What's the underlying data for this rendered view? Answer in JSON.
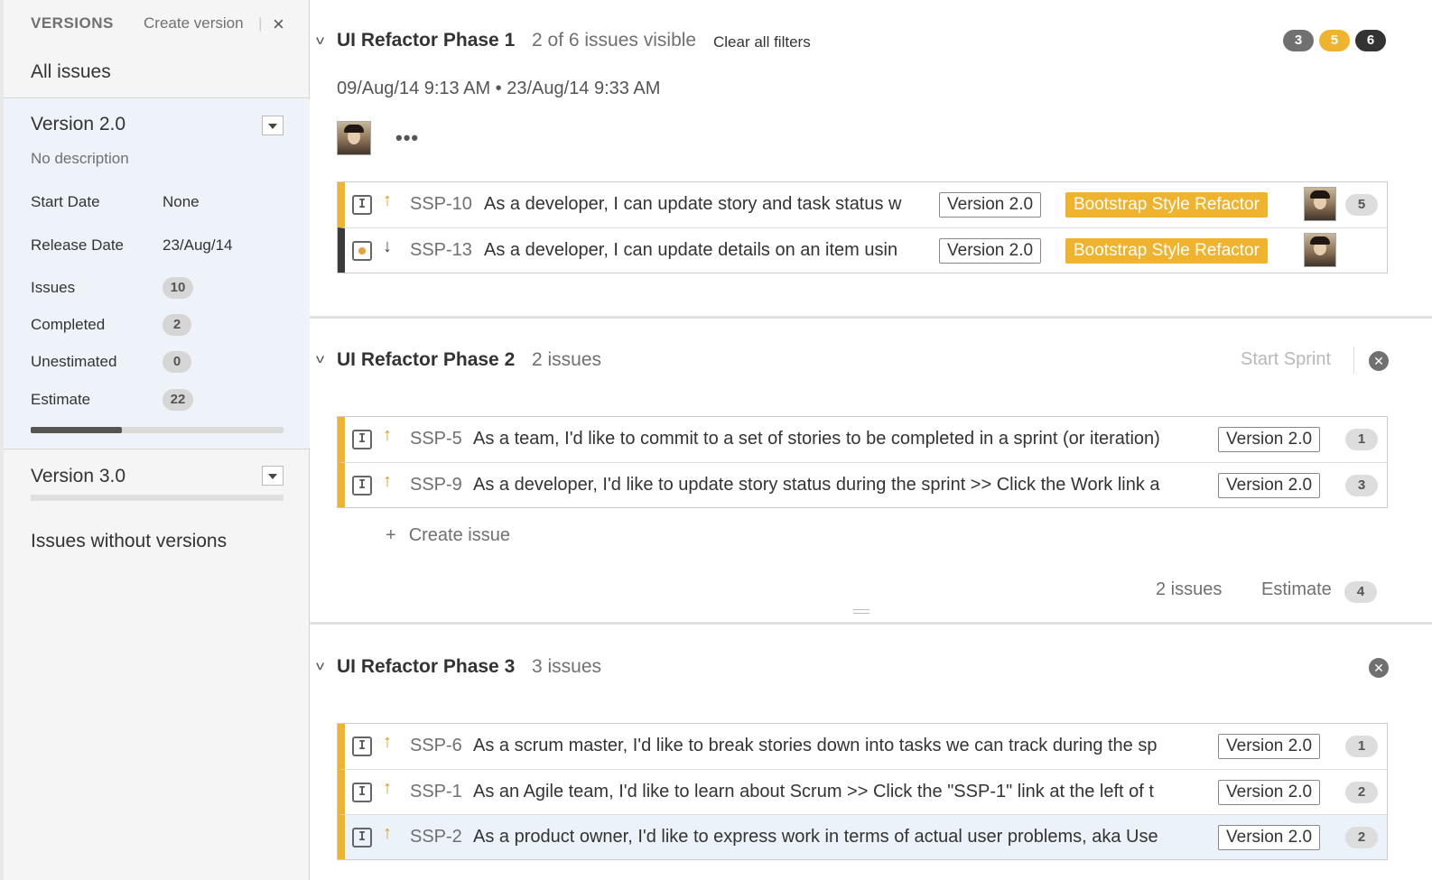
{
  "sidebar": {
    "title": "VERSIONS",
    "create_label": "Create version",
    "separator": "|",
    "close_label": "×",
    "all_issues": "All issues",
    "version_2": {
      "name": "Version 2.0",
      "description": "No description",
      "start_date_label": "Start Date",
      "start_date": "None",
      "release_date_label": "Release Date",
      "release_date": "23/Aug/14",
      "issues_label": "Issues",
      "issues": "10",
      "completed_label": "Completed",
      "completed": "2",
      "unestimated_label": "Unestimated",
      "unestimated": "0",
      "estimate_label": "Estimate",
      "estimate": "22",
      "progress_fraction": 0.36
    },
    "version_3": {
      "name": "Version 3.0"
    },
    "issues_without_versions": "Issues without versions"
  },
  "sprints": [
    {
      "title": "UI Refactor Phase 1",
      "count": "2 of 6 issues visible",
      "clear_filters": "Clear all filters",
      "dates": "09/Aug/14 9:13 AM • 23/Aug/14 9:33 AM",
      "more": "•••",
      "status_counts": [
        {
          "value": "3",
          "color": "#707070"
        },
        {
          "value": "5",
          "color": "#f0b32e"
        },
        {
          "value": "6",
          "color": "#333333"
        }
      ],
      "issues": [
        {
          "key": "SSP-10",
          "summary": "As a developer, I can update story and task status w",
          "version": "Version 2.0",
          "epic": "Bootstrap Style Refactor",
          "estimate": "5",
          "type": "story-icon",
          "priority": "up"
        },
        {
          "key": "SSP-13",
          "summary": "As a developer, I can update details on an item usin",
          "version": "Version 2.0",
          "epic": "Bootstrap Style Refactor",
          "estimate": "",
          "type": "bug-icon",
          "priority": "down"
        }
      ]
    },
    {
      "title": "UI Refactor Phase 2",
      "count": "2 issues",
      "start_sprint": "Start Sprint",
      "issues": [
        {
          "key": "SSP-5",
          "summary": "As a team, I'd like to commit to a set of stories to be completed in a sprint (or iteration)",
          "version": "Version 2.0",
          "estimate": "1"
        },
        {
          "key": "SSP-9",
          "summary": "As a developer, I'd like to update story status during the sprint >> Click the Work link a",
          "version": "Version 2.0",
          "estimate": "3"
        }
      ],
      "create_issue": "Create issue",
      "footer_issues": "2 issues",
      "footer_estimate_label": "Estimate",
      "footer_estimate": "4"
    },
    {
      "title": "UI Refactor Phase 3",
      "count": "3 issues",
      "issues": [
        {
          "key": "SSP-6",
          "summary": "As a scrum master, I'd like to break stories down into tasks we can track during the sp",
          "version": "Version 2.0",
          "estimate": "1"
        },
        {
          "key": "SSP-1",
          "summary": "As an Agile team, I'd like to learn about Scrum >> Click the \"SSP-1\" link at the left of t",
          "version": "Version 2.0",
          "estimate": "2"
        },
        {
          "key": "SSP-2",
          "summary": "As a product owner, I'd like to express work in terms of actual user problems, aka Use",
          "version": "Version 2.0",
          "estimate": "2"
        }
      ]
    }
  ],
  "icons": {
    "story": "I",
    "priority_up": "↑",
    "priority_down": "↓",
    "chevron": "v",
    "remove": "✕",
    "plus": "+"
  },
  "colors": {
    "accent": "#f0b32e",
    "sidebar_bg": "#f5f5f5",
    "version_bg": "#eef3fa"
  }
}
